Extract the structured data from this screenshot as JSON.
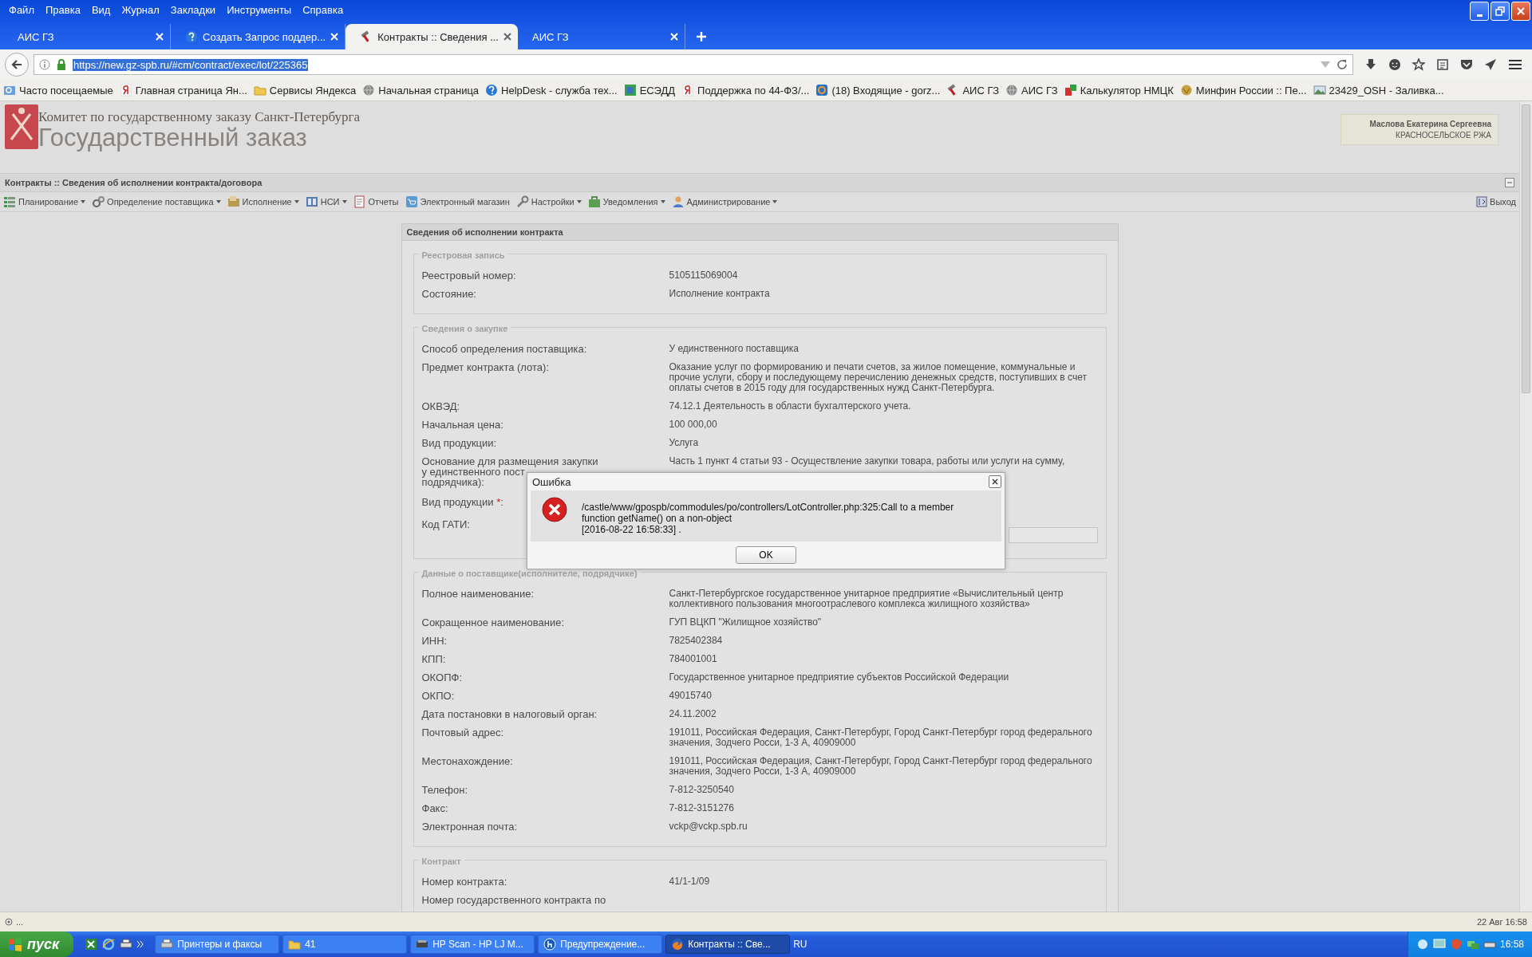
{
  "browser": {
    "menu": [
      "Файл",
      "Правка",
      "Вид",
      "Журнал",
      "Закладки",
      "Инструменты",
      "Справка"
    ],
    "tabs": [
      {
        "label": "АИС ГЗ",
        "selected": false
      },
      {
        "label": "Создать Запрос поддер...",
        "selected": false
      },
      {
        "label": "Контракты :: Сведения ...",
        "selected": true
      },
      {
        "label": "АИС ГЗ",
        "selected": false
      }
    ],
    "url": "https://new.gz-spb.ru/#cm/contract/exec/lot/225365",
    "bookmarks": [
      {
        "label": "Часто посещаемые"
      },
      {
        "label": "Главная страница Ян..."
      },
      {
        "label": "Сервисы Яндекса"
      },
      {
        "label": "Начальная страница"
      },
      {
        "label": "HelpDesk - служба тех..."
      },
      {
        "label": "ЕСЭДД"
      },
      {
        "label": "Поддержка по 44-ФЗ/..."
      },
      {
        "label": "(18) Входящие - gorz..."
      },
      {
        "label": "АИС ГЗ"
      },
      {
        "label": "АИС ГЗ"
      },
      {
        "label": "Калькулятор НМЦК"
      },
      {
        "label": "Минфин России :: Пе..."
      },
      {
        "label": "23429_OSH - Заливка..."
      }
    ]
  },
  "header": {
    "org": "Комитет по государственному заказу Санкт-Петербурга",
    "title": "Государственный заказ",
    "user_name": "Маслова Екатерина Сергеевна",
    "user_unit": "КРАСНОСЕЛЬСКОЕ РЖА"
  },
  "page_title": "Контракты :: Сведения об исполнении контракта/договора",
  "toolbar": [
    {
      "label": "Планирование",
      "dropdown": true
    },
    {
      "label": "Определение поставщика",
      "dropdown": true
    },
    {
      "label": "Исполнение",
      "dropdown": true
    },
    {
      "label": "НСИ",
      "dropdown": true
    },
    {
      "label": "Отчеты",
      "dropdown": false
    },
    {
      "label": "Электронный магазин",
      "dropdown": false
    },
    {
      "label": "Настройки",
      "dropdown": true
    },
    {
      "label": "Уведомления",
      "dropdown": true
    },
    {
      "label": "Администрирование",
      "dropdown": true
    }
  ],
  "logout": "Выход",
  "panel": {
    "title": "Сведения об исполнении контракта",
    "sections": [
      {
        "legend": "Реестровая запись",
        "rows": [
          {
            "label": "Реестровый номер:",
            "value": "5105115069004"
          },
          {
            "label": "Состояние:",
            "value": "Исполнение контракта"
          }
        ]
      },
      {
        "legend": "Сведения о закупке",
        "rows": [
          {
            "label": "Способ определения поставщика:",
            "value": "У единственного поставщика"
          },
          {
            "label": "Предмет контракта (лота):",
            "value": "Оказание услуг по формированию и печати счетов, за жилое помещение, коммунальные и прочие услуги, сбору и последующему перечислению денежных средств, поступивших в счет оплаты счетов в 2015 году для государственных нужд Санкт-Петербурга."
          },
          {
            "label": "ОКВЭД:",
            "value": "74.12.1 Деятельность в области бухгалтерского учета."
          },
          {
            "label": "Начальная цена:",
            "value": "100 000,00"
          },
          {
            "label": "Вид продукции:",
            "value": "Услуга"
          },
          {
            "label_lines": [
              "Основание для размещения закупки",
              "у единственного пост",
              "подрядчика):"
            ],
            "value": "Часть 1 пункт 4 статьи 93 - Осуществление закупки товара, работы или услуги на сумму,"
          },
          {
            "label": "Вид продукции",
            "required_mark": "*",
            "label_end": ":"
          },
          {
            "label": "Код ГАТИ:",
            "kind": "field"
          }
        ]
      },
      {
        "legend": "Данные о поставщике(исполнителе, подрядчике)",
        "rows": [
          {
            "label": "Полное наименование:",
            "value": "Санкт-Петербургское государственное унитарное предприятие «Вычислительный центр коллективного пользования многоотраслевого комплекса жилищного хозяйства»"
          },
          {
            "label": "Сокращенное наименование:",
            "value": "ГУП ВЦКП \"Жилищное хозяйство\""
          },
          {
            "label": "ИНН:",
            "value": "7825402384"
          },
          {
            "label": "КПП:",
            "value": "784001001"
          },
          {
            "label": "ОКОПФ:",
            "value": "Государственное унитарное предприятие субъектов Российской Федерации"
          },
          {
            "label": "ОКПО:",
            "value": "49015740"
          },
          {
            "label": "Дата постановки в налоговый орган:",
            "value": "24.11.2002"
          },
          {
            "label": "Почтовый адрес:",
            "value": "191011, Российская Федерация, Санкт-Петербург, Город Санкт-Петербург город федерального значения, Зодчего Росси, 1-3 А, 40909000"
          },
          {
            "label": "Местонахождение:",
            "value": "191011, Российская Федерация, Санкт-Петербург, Город Санкт-Петербург город федерального значения, Зодчего Росси, 1-3 А, 40909000"
          },
          {
            "label": "Телефон:",
            "value": "7-812-3250540"
          },
          {
            "label": "Факс:",
            "value": "7-812-3151276"
          },
          {
            "label": "Электронная почта:",
            "value": "vckp@vckp.spb.ru"
          }
        ]
      },
      {
        "legend": "Контракт",
        "rows": [
          {
            "label": "Номер контракта:",
            "value": "41/1-1/09"
          },
          {
            "label": "Номер государственного контракта по"
          }
        ]
      }
    ]
  },
  "dialog": {
    "title": "Ошибка",
    "message": "/castle/www/gpospb/commodules/po/controllers/LotController.php:325:Call to a member function getName() on a non-object",
    "timestamp": "[2016-08-22 16:58:33] .",
    "button": "OK"
  },
  "status_bar": {
    "text": "...",
    "datetime": "22 Авг 16:58"
  },
  "taskbar": {
    "start": "пуск",
    "tasks": [
      {
        "label": "Принтеры и факсы",
        "selected": false
      },
      {
        "label": "41",
        "selected": false
      },
      {
        "label": "HP Scan - HP LJ M...",
        "selected": false
      },
      {
        "label": "Предупреждение...",
        "selected": false
      },
      {
        "label": "Контракты :: Све...",
        "selected": true
      }
    ],
    "lang": "RU",
    "clock": "16:58"
  }
}
